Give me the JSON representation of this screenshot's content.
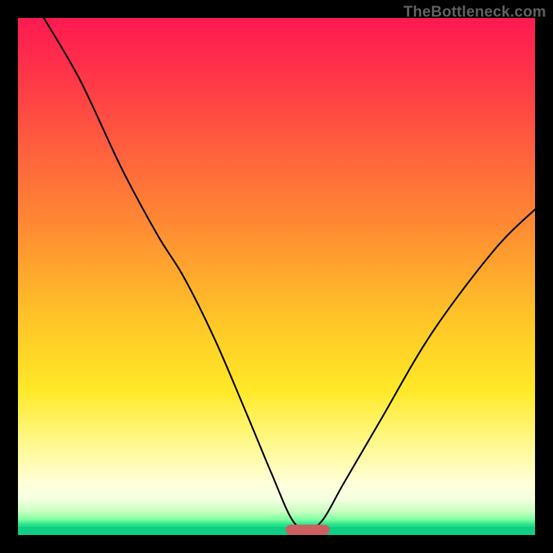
{
  "watermark": "TheBottleneck.com",
  "colors": {
    "background": "#000000",
    "curve": "#000000",
    "pill": "#cc6060",
    "green": "#0fcf84",
    "gradient_top": "#ff1a52",
    "gradient_bottom": "#0fcf84"
  },
  "chart_data": {
    "type": "line",
    "title": "",
    "xlabel": "",
    "ylabel": "",
    "xlim": [
      0,
      100
    ],
    "ylim": [
      0,
      100
    ],
    "annotations": [
      {
        "kind": "pill-marker",
        "x": 56,
        "y": 1
      }
    ],
    "series": [
      {
        "name": "bottleneck-curve",
        "x": [
          5,
          12,
          20,
          27,
          32,
          38,
          44,
          49,
          53,
          56,
          59,
          63,
          70,
          80,
          92,
          100
        ],
        "values": [
          100,
          88,
          71,
          58,
          50,
          38,
          24,
          12,
          3,
          1,
          3,
          10,
          22,
          39,
          55,
          63
        ]
      }
    ]
  }
}
